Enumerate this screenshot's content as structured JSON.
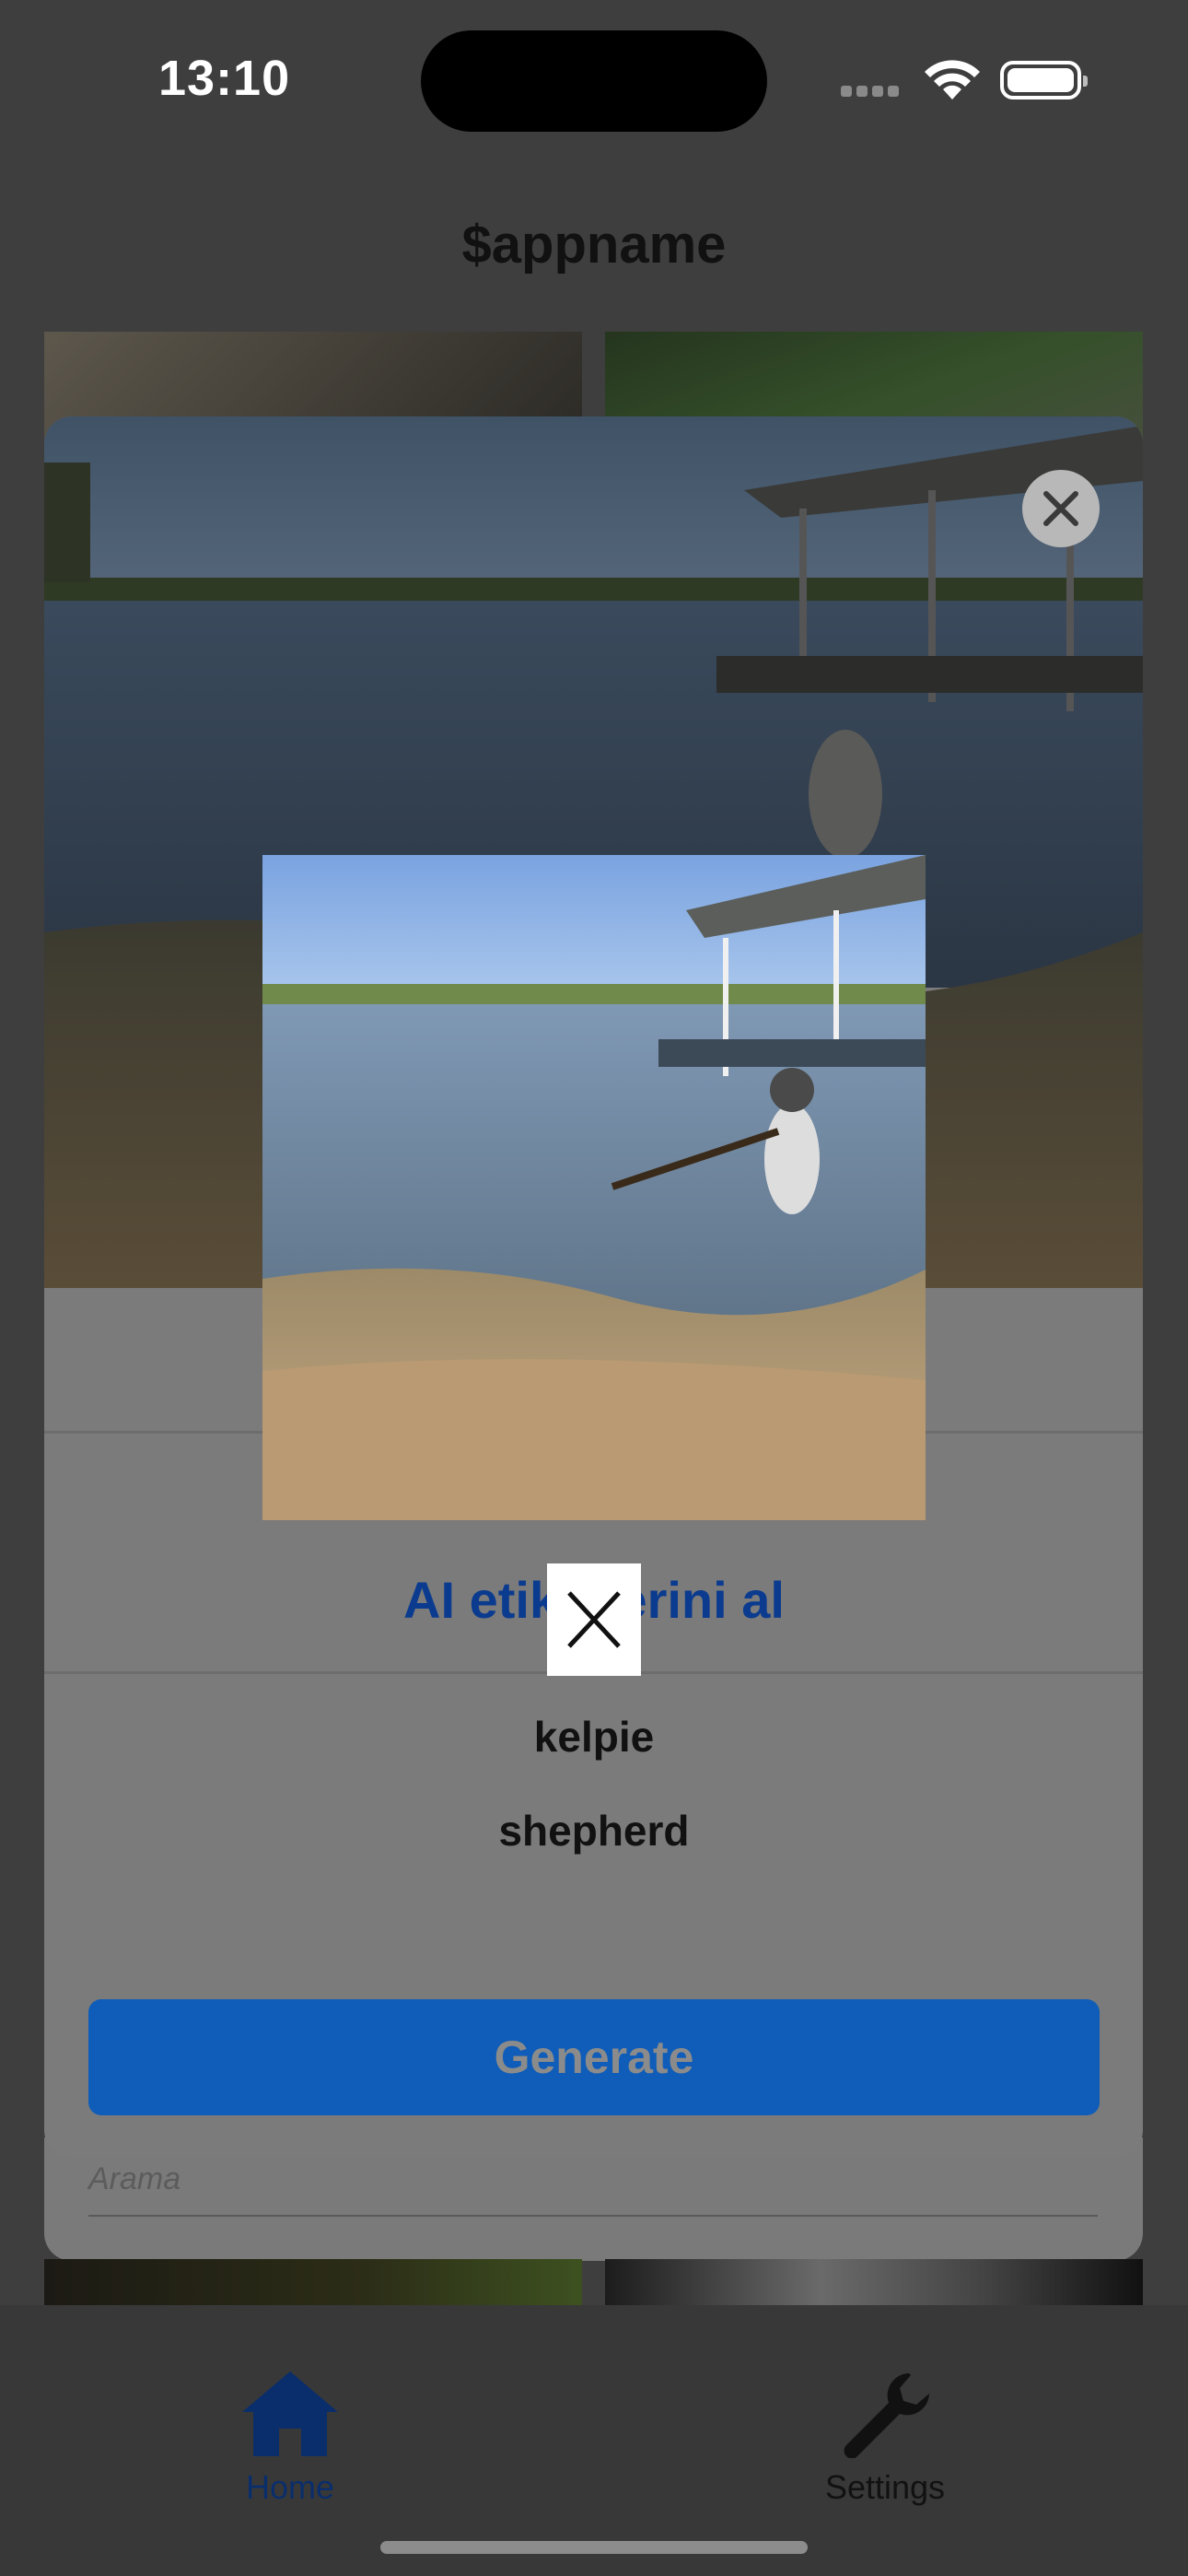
{
  "status_bar": {
    "time": "13:10"
  },
  "app": {
    "title": "$appname"
  },
  "modal": {
    "ai_label": "AI etiketlerini al",
    "tags": [
      "kelpie",
      "shepherd"
    ],
    "generate_label": "Generate"
  },
  "search": {
    "placeholder": "Arama"
  },
  "tabbar": {
    "items": [
      {
        "label": "Home",
        "icon": "home-icon",
        "active": true
      },
      {
        "label": "Settings",
        "icon": "wrench-icon",
        "active": false
      }
    ]
  },
  "colors": {
    "accent": "#0f5db8",
    "overlay": "#3e3e3e",
    "active_tab": "#0a2e6b"
  }
}
